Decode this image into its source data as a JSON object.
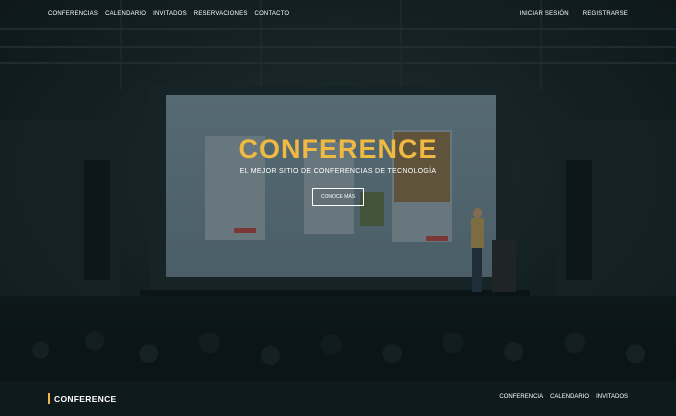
{
  "nav": {
    "left": [
      "CONFERENCIAS",
      "CALENDARIO",
      "INVITADOS",
      "RESERVACIONES",
      "CONTACTO"
    ],
    "right": [
      "INICIAR SESIÓN",
      "REGISTRARSE"
    ]
  },
  "hero": {
    "title": "CONFERENCE",
    "subtitle": "EL MEJOR SITIO DE CONFERENCIAS DE TECNOLOGÍA",
    "cta": "CONOCE MÁS"
  },
  "footer": {
    "brand": "CONFERENCE",
    "links": [
      "CONFERENCIA",
      "CALENDARIO",
      "INVITADOS"
    ]
  },
  "colors": {
    "accent": "#f0b941",
    "footer_bg": "#0f1a1d"
  }
}
